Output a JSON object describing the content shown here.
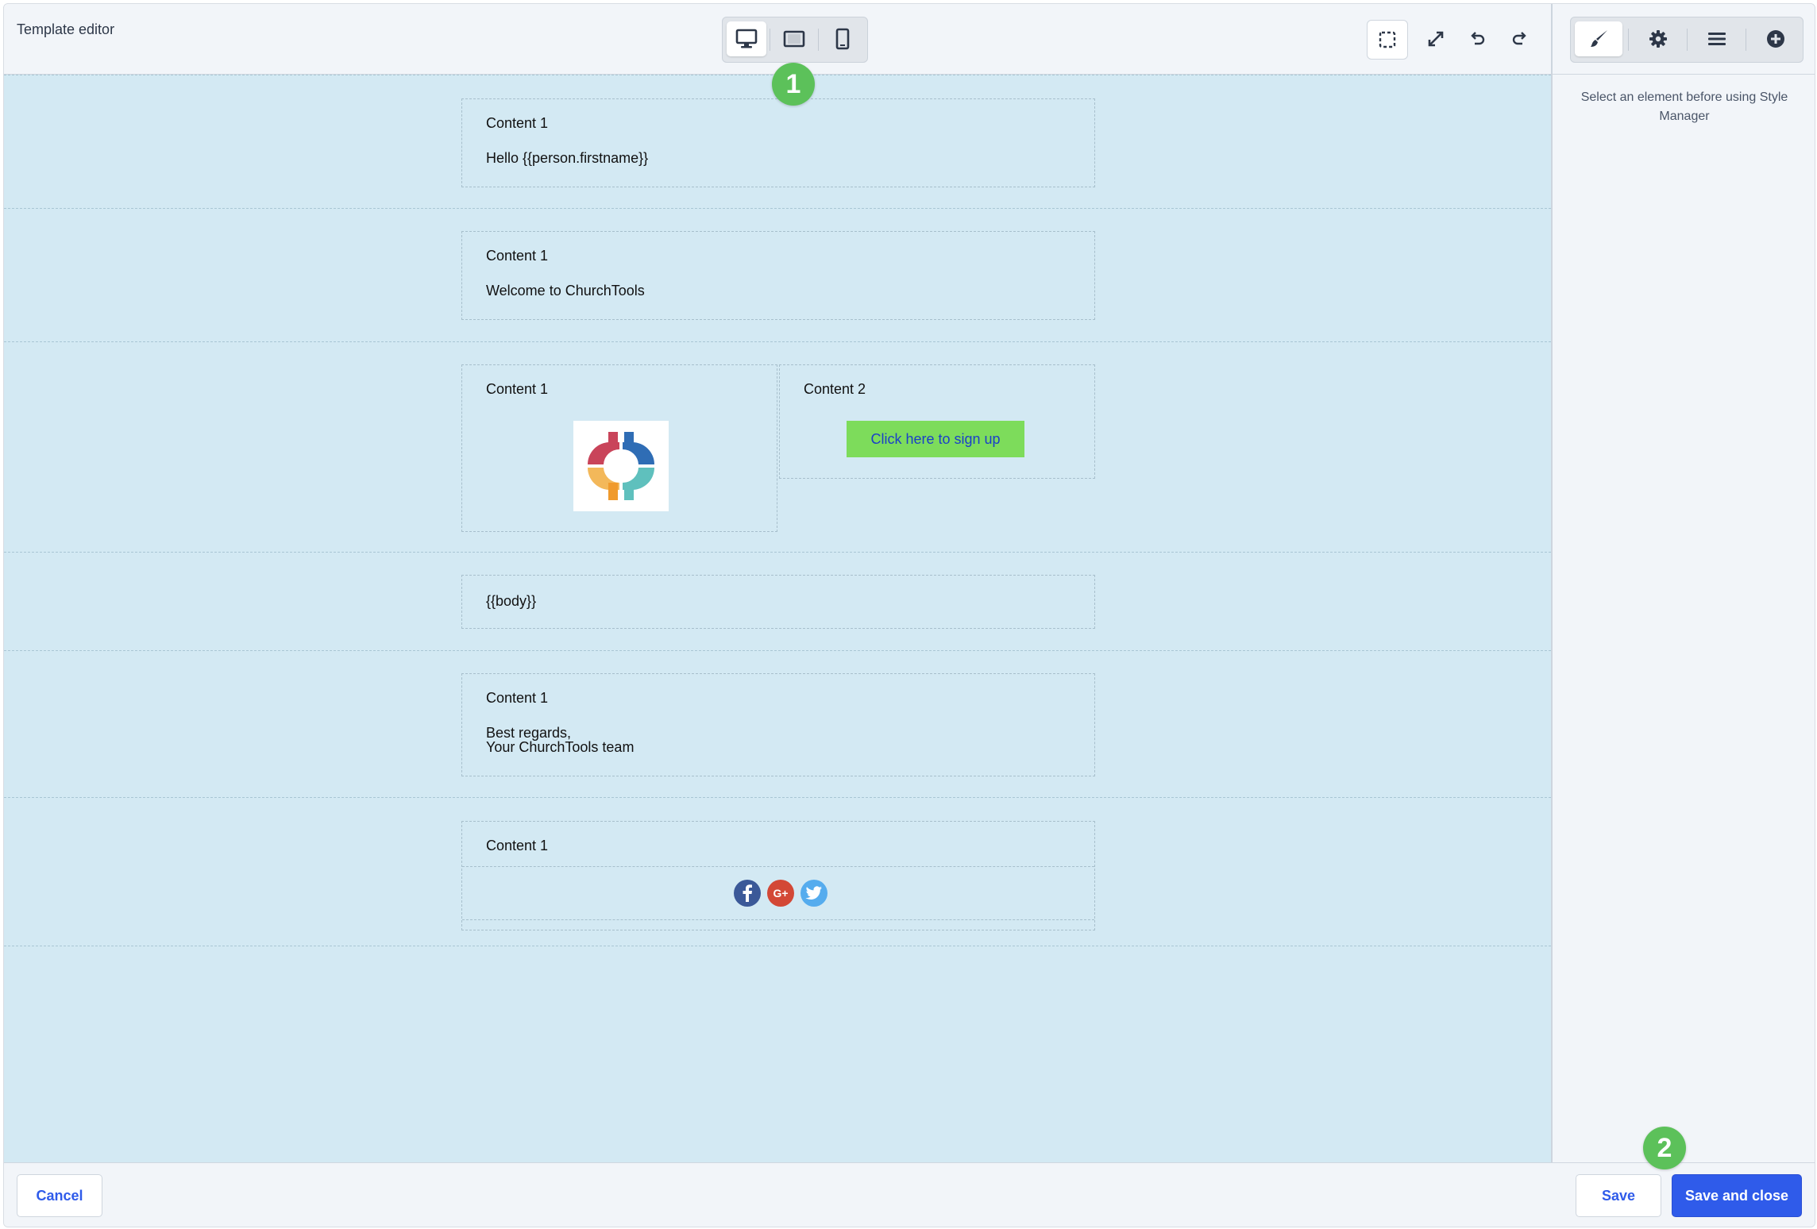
{
  "header": {
    "title": "Template editor"
  },
  "device_toolbar": {
    "active": "desktop",
    "devices": [
      "desktop-icon",
      "tablet-icon",
      "mobile-icon"
    ]
  },
  "tools": [
    "select-outline-icon",
    "fullscreen-icon",
    "undo-icon",
    "redo-icon"
  ],
  "badges": {
    "first": "1",
    "second": "2"
  },
  "canvas": {
    "rows": [
      {
        "label": "Content 1",
        "text": "Hello {{person.firstname}}"
      },
      {
        "label": "Content 1",
        "text": "Welcome to ChurchTools"
      },
      {
        "col1_label": "Content 1",
        "col2_label": "Content 2",
        "cta": "Click here to sign up"
      },
      {
        "text": "{{body}}"
      },
      {
        "label": "Content 1",
        "line1": "Best regards,",
        "line2": "Your ChurchTools team"
      },
      {
        "label": "Content 1",
        "social": [
          "facebook-icon",
          "google-plus-icon",
          "twitter-icon"
        ],
        "google_text": "G+"
      }
    ]
  },
  "right_panel": {
    "tabs": [
      "brush-icon",
      "gear-icon",
      "layers-icon",
      "add-circle-icon"
    ],
    "active_tab": "brush-icon",
    "hint": "Select an element before using Style Manager"
  },
  "footer": {
    "cancel": "Cancel",
    "save": "Save",
    "save_close": "Save and close"
  },
  "colors": {
    "accent": "#2f5bea",
    "canvas": "#d3e9f3",
    "badge": "#5cc15a",
    "cta": "#7ddc5b"
  }
}
